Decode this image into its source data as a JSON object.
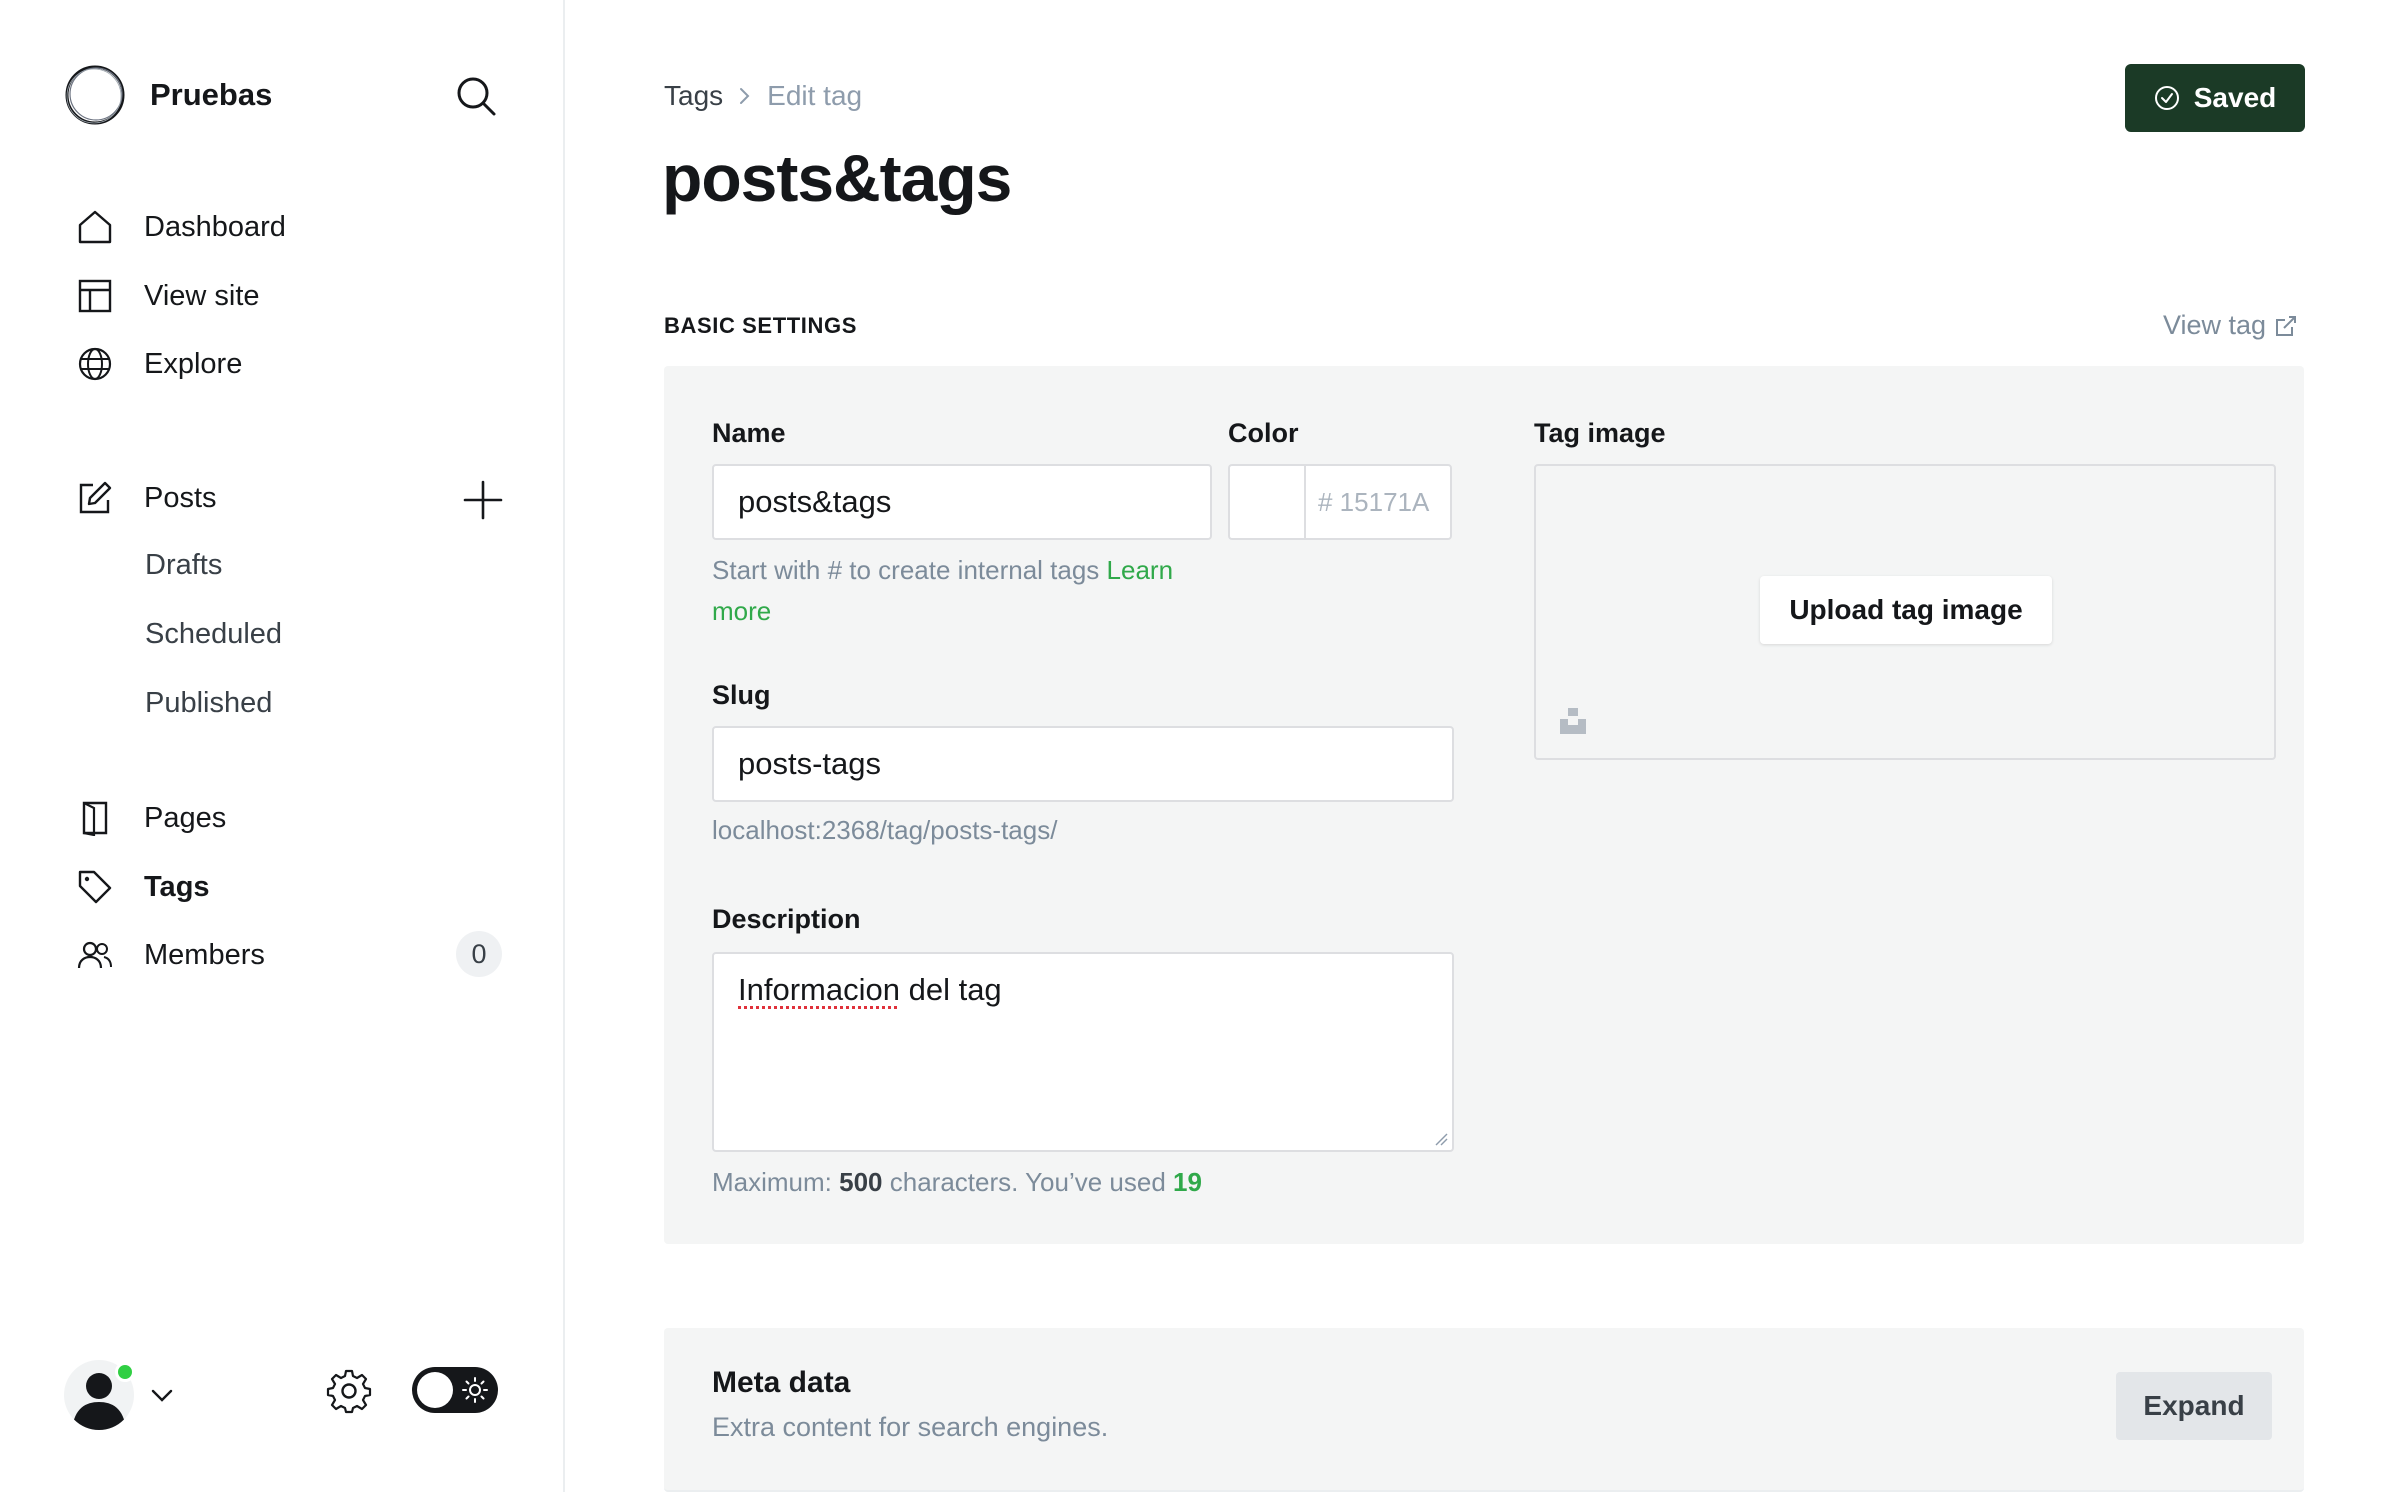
{
  "sidebar": {
    "site_name": "Pruebas",
    "nav": {
      "dashboard": "Dashboard",
      "view_site": "View site",
      "explore": "Explore",
      "posts": "Posts",
      "drafts": "Drafts",
      "scheduled": "Scheduled",
      "published": "Published",
      "pages": "Pages",
      "tags": "Tags",
      "members": "Members",
      "members_count": "0"
    }
  },
  "header": {
    "breadcrumb_parent": "Tags",
    "breadcrumb_current": "Edit tag",
    "title": "posts&tags",
    "saved_label": "Saved"
  },
  "basic_settings": {
    "section_label": "BASIC SETTINGS",
    "view_tag_label": "View tag",
    "name_label": "Name",
    "name_value": "posts&tags",
    "name_hint": "Start with # to create internal tags ",
    "name_hint_link": "Learn more",
    "color_label": "Color",
    "color_value": "# 15171A",
    "tag_image_label": "Tag image",
    "upload_label": "Upload tag image",
    "slug_label": "Slug",
    "slug_value": "posts-tags",
    "slug_url": "localhost:2368/tag/posts-tags/",
    "description_label": "Description",
    "description_value": "del tag",
    "description_spell_word": "Informacion",
    "description_hint_prefix": "Maximum: ",
    "description_max": "500",
    "description_hint_mid": " characters. You’ve used ",
    "description_used": "19"
  },
  "meta_data": {
    "title": "Meta data",
    "subtitle": "Extra content for search engines.",
    "expand_label": "Expand"
  },
  "colors": {
    "saved_button": "#1b3a26",
    "accent_green": "#30a94a",
    "online_dot": "#30cf43"
  }
}
